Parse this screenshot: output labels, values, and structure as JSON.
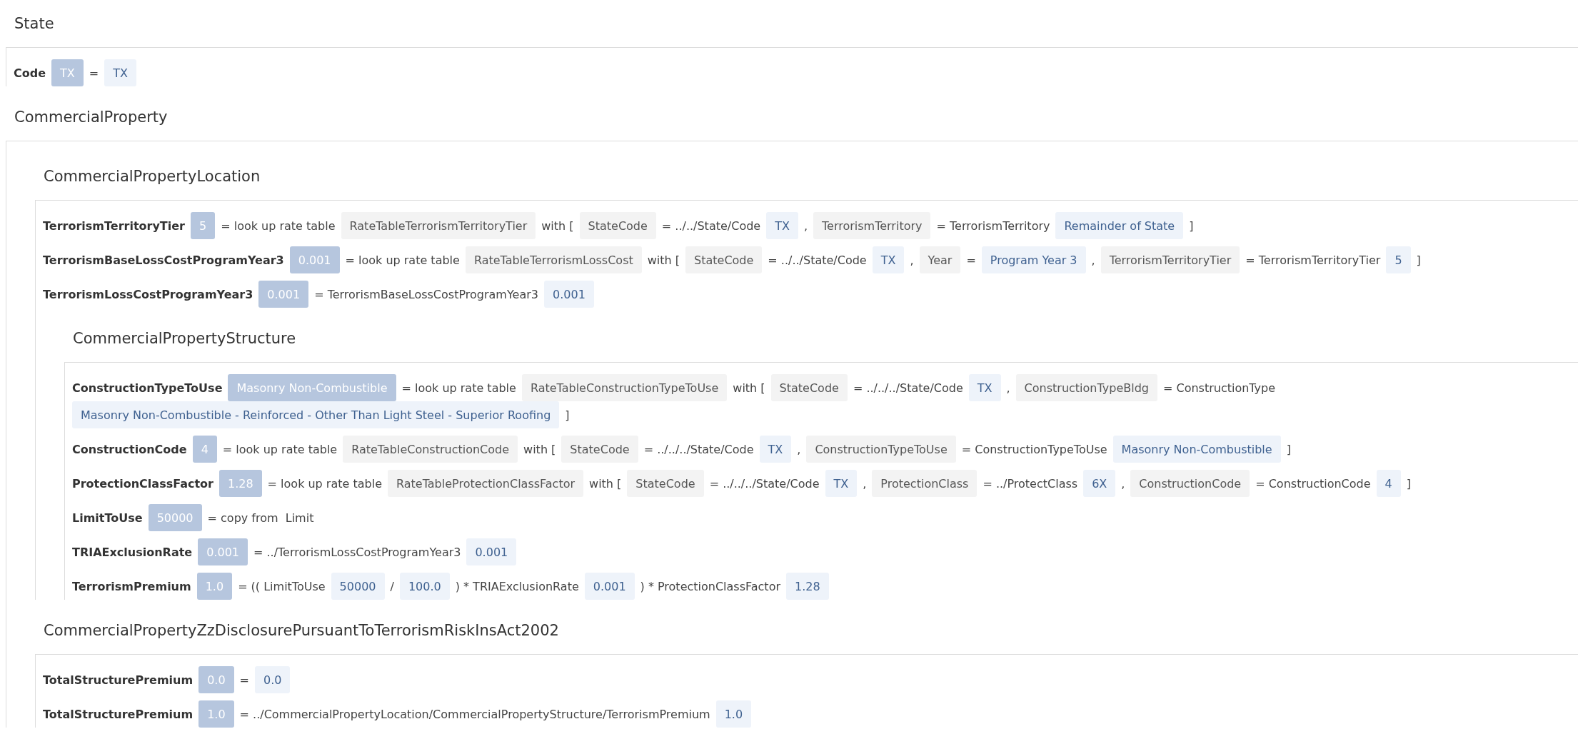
{
  "sections": [
    {
      "title": "State",
      "rows": [
        {
          "name": "Code",
          "result": "TX",
          "expr": [
            {
              "kind": "text",
              "text": "="
            },
            {
              "kind": "value",
              "text": "TX"
            }
          ]
        }
      ]
    },
    {
      "title": "CommercialProperty",
      "children": [
        {
          "title": "CommercialPropertyLocation",
          "rows": [
            {
              "name": "TerrorismTerritoryTier",
              "result": "5",
              "expr": [
                {
                  "kind": "text",
                  "text": "= look up rate table"
                },
                {
                  "kind": "ref",
                  "text": "RateTableTerrorismTerritoryTier"
                },
                {
                  "kind": "text",
                  "text": "with ["
                },
                {
                  "kind": "ref",
                  "text": "StateCode"
                },
                {
                  "kind": "text",
                  "text": "= ../../State/Code"
                },
                {
                  "kind": "value",
                  "text": "TX"
                },
                {
                  "kind": "text",
                  "text": ","
                },
                {
                  "kind": "ref",
                  "text": "TerrorismTerritory"
                },
                {
                  "kind": "text",
                  "text": "= TerrorismTerritory"
                },
                {
                  "kind": "value",
                  "text": "Remainder of State"
                },
                {
                  "kind": "text",
                  "text": "]"
                }
              ]
            },
            {
              "name": "TerrorismBaseLossCostProgramYear3",
              "result": "0.001",
              "expr": [
                {
                  "kind": "text",
                  "text": "= look up rate table"
                },
                {
                  "kind": "ref",
                  "text": "RateTableTerrorismLossCost"
                },
                {
                  "kind": "text",
                  "text": "with ["
                },
                {
                  "kind": "ref",
                  "text": "StateCode"
                },
                {
                  "kind": "text",
                  "text": "= ../../State/Code"
                },
                {
                  "kind": "value",
                  "text": "TX"
                },
                {
                  "kind": "text",
                  "text": ","
                },
                {
                  "kind": "ref",
                  "text": "Year"
                },
                {
                  "kind": "text",
                  "text": "="
                },
                {
                  "kind": "value",
                  "text": "Program Year 3"
                },
                {
                  "kind": "text",
                  "text": ","
                },
                {
                  "kind": "ref",
                  "text": "TerrorismTerritoryTier"
                },
                {
                  "kind": "text",
                  "text": "= TerrorismTerritoryTier"
                },
                {
                  "kind": "value",
                  "text": "5"
                },
                {
                  "kind": "text",
                  "text": "]"
                }
              ]
            },
            {
              "name": "TerrorismLossCostProgramYear3",
              "result": "0.001",
              "expr": [
                {
                  "kind": "text",
                  "text": "= TerrorismBaseLossCostProgramYear3"
                },
                {
                  "kind": "value",
                  "text": "0.001"
                }
              ]
            }
          ],
          "children": [
            {
              "title": "CommercialPropertyStructure",
              "rows": [
                {
                  "name": "ConstructionTypeToUse",
                  "result": "Masonry Non-Combustible",
                  "expr": [
                    {
                      "kind": "text",
                      "text": "= look up rate table"
                    },
                    {
                      "kind": "ref",
                      "text": "RateTableConstructionTypeToUse"
                    },
                    {
                      "kind": "text",
                      "text": "with ["
                    },
                    {
                      "kind": "ref",
                      "text": "StateCode"
                    },
                    {
                      "kind": "text",
                      "text": "= ../../../State/Code"
                    },
                    {
                      "kind": "value",
                      "text": "TX"
                    },
                    {
                      "kind": "text",
                      "text": ","
                    },
                    {
                      "kind": "ref",
                      "text": "ConstructionTypeBldg"
                    },
                    {
                      "kind": "text",
                      "text": "= ConstructionType"
                    },
                    {
                      "kind": "value",
                      "text": "Masonry Non-Combustible - Reinforced - Other Than Light Steel - Superior Roofing"
                    },
                    {
                      "kind": "text",
                      "text": "]"
                    }
                  ]
                },
                {
                  "name": "ConstructionCode",
                  "result": "4",
                  "expr": [
                    {
                      "kind": "text",
                      "text": "= look up rate table"
                    },
                    {
                      "kind": "ref",
                      "text": "RateTableConstructionCode"
                    },
                    {
                      "kind": "text",
                      "text": "with ["
                    },
                    {
                      "kind": "ref",
                      "text": "StateCode"
                    },
                    {
                      "kind": "text",
                      "text": "= ../../../State/Code"
                    },
                    {
                      "kind": "value",
                      "text": "TX"
                    },
                    {
                      "kind": "text",
                      "text": ","
                    },
                    {
                      "kind": "ref",
                      "text": "ConstructionTypeToUse"
                    },
                    {
                      "kind": "text",
                      "text": "= ConstructionTypeToUse"
                    },
                    {
                      "kind": "value",
                      "text": "Masonry Non-Combustible"
                    },
                    {
                      "kind": "text",
                      "text": "]"
                    }
                  ]
                },
                {
                  "name": "ProtectionClassFactor",
                  "result": "1.28",
                  "expr": [
                    {
                      "kind": "text",
                      "text": "= look up rate table"
                    },
                    {
                      "kind": "ref",
                      "text": "RateTableProtectionClassFactor"
                    },
                    {
                      "kind": "text",
                      "text": "with ["
                    },
                    {
                      "kind": "ref",
                      "text": "StateCode"
                    },
                    {
                      "kind": "text",
                      "text": "= ../../../State/Code"
                    },
                    {
                      "kind": "value",
                      "text": "TX"
                    },
                    {
                      "kind": "text",
                      "text": ","
                    },
                    {
                      "kind": "ref",
                      "text": "ProtectionClass"
                    },
                    {
                      "kind": "text",
                      "text": "= ../ProtectClass"
                    },
                    {
                      "kind": "value",
                      "text": "6X"
                    },
                    {
                      "kind": "text",
                      "text": ","
                    },
                    {
                      "kind": "ref",
                      "text": "ConstructionCode"
                    },
                    {
                      "kind": "text",
                      "text": "= ConstructionCode"
                    },
                    {
                      "kind": "value",
                      "text": "4"
                    },
                    {
                      "kind": "text",
                      "text": "]"
                    }
                  ]
                },
                {
                  "name": "LimitToUse",
                  "result": "50000",
                  "expr": [
                    {
                      "kind": "text",
                      "text": "= copy from  Limit"
                    }
                  ]
                },
                {
                  "name": "TRIAExclusionRate",
                  "result": "0.001",
                  "expr": [
                    {
                      "kind": "text",
                      "text": "= ../TerrorismLossCostProgramYear3"
                    },
                    {
                      "kind": "value",
                      "text": "0.001"
                    }
                  ]
                },
                {
                  "name": "TerrorismPremium",
                  "result": "1.0",
                  "expr": [
                    {
                      "kind": "text",
                      "text": "= (( LimitToUse"
                    },
                    {
                      "kind": "value",
                      "text": "50000"
                    },
                    {
                      "kind": "text",
                      "text": "/"
                    },
                    {
                      "kind": "value",
                      "text": "100.0"
                    },
                    {
                      "kind": "text",
                      "text": ") * TRIAExclusionRate"
                    },
                    {
                      "kind": "value",
                      "text": "0.001"
                    },
                    {
                      "kind": "text",
                      "text": ") * ProtectionClassFactor"
                    },
                    {
                      "kind": "value",
                      "text": "1.28"
                    }
                  ]
                }
              ]
            }
          ]
        },
        {
          "title": "CommercialPropertyZzDisclosurePursuantToTerrorismRiskInsAct2002",
          "rows": [
            {
              "name": "TotalStructurePremium",
              "result": "0.0",
              "expr": [
                {
                  "kind": "text",
                  "text": "="
                },
                {
                  "kind": "value",
                  "text": "0.0"
                }
              ]
            },
            {
              "name": "TotalStructurePremium",
              "result": "1.0",
              "expr": [
                {
                  "kind": "text",
                  "text": "= ../CommercialPropertyLocation/CommercialPropertyStructure/TerrorismPremium"
                },
                {
                  "kind": "value",
                  "text": "1.0"
                }
              ]
            }
          ]
        }
      ]
    }
  ]
}
